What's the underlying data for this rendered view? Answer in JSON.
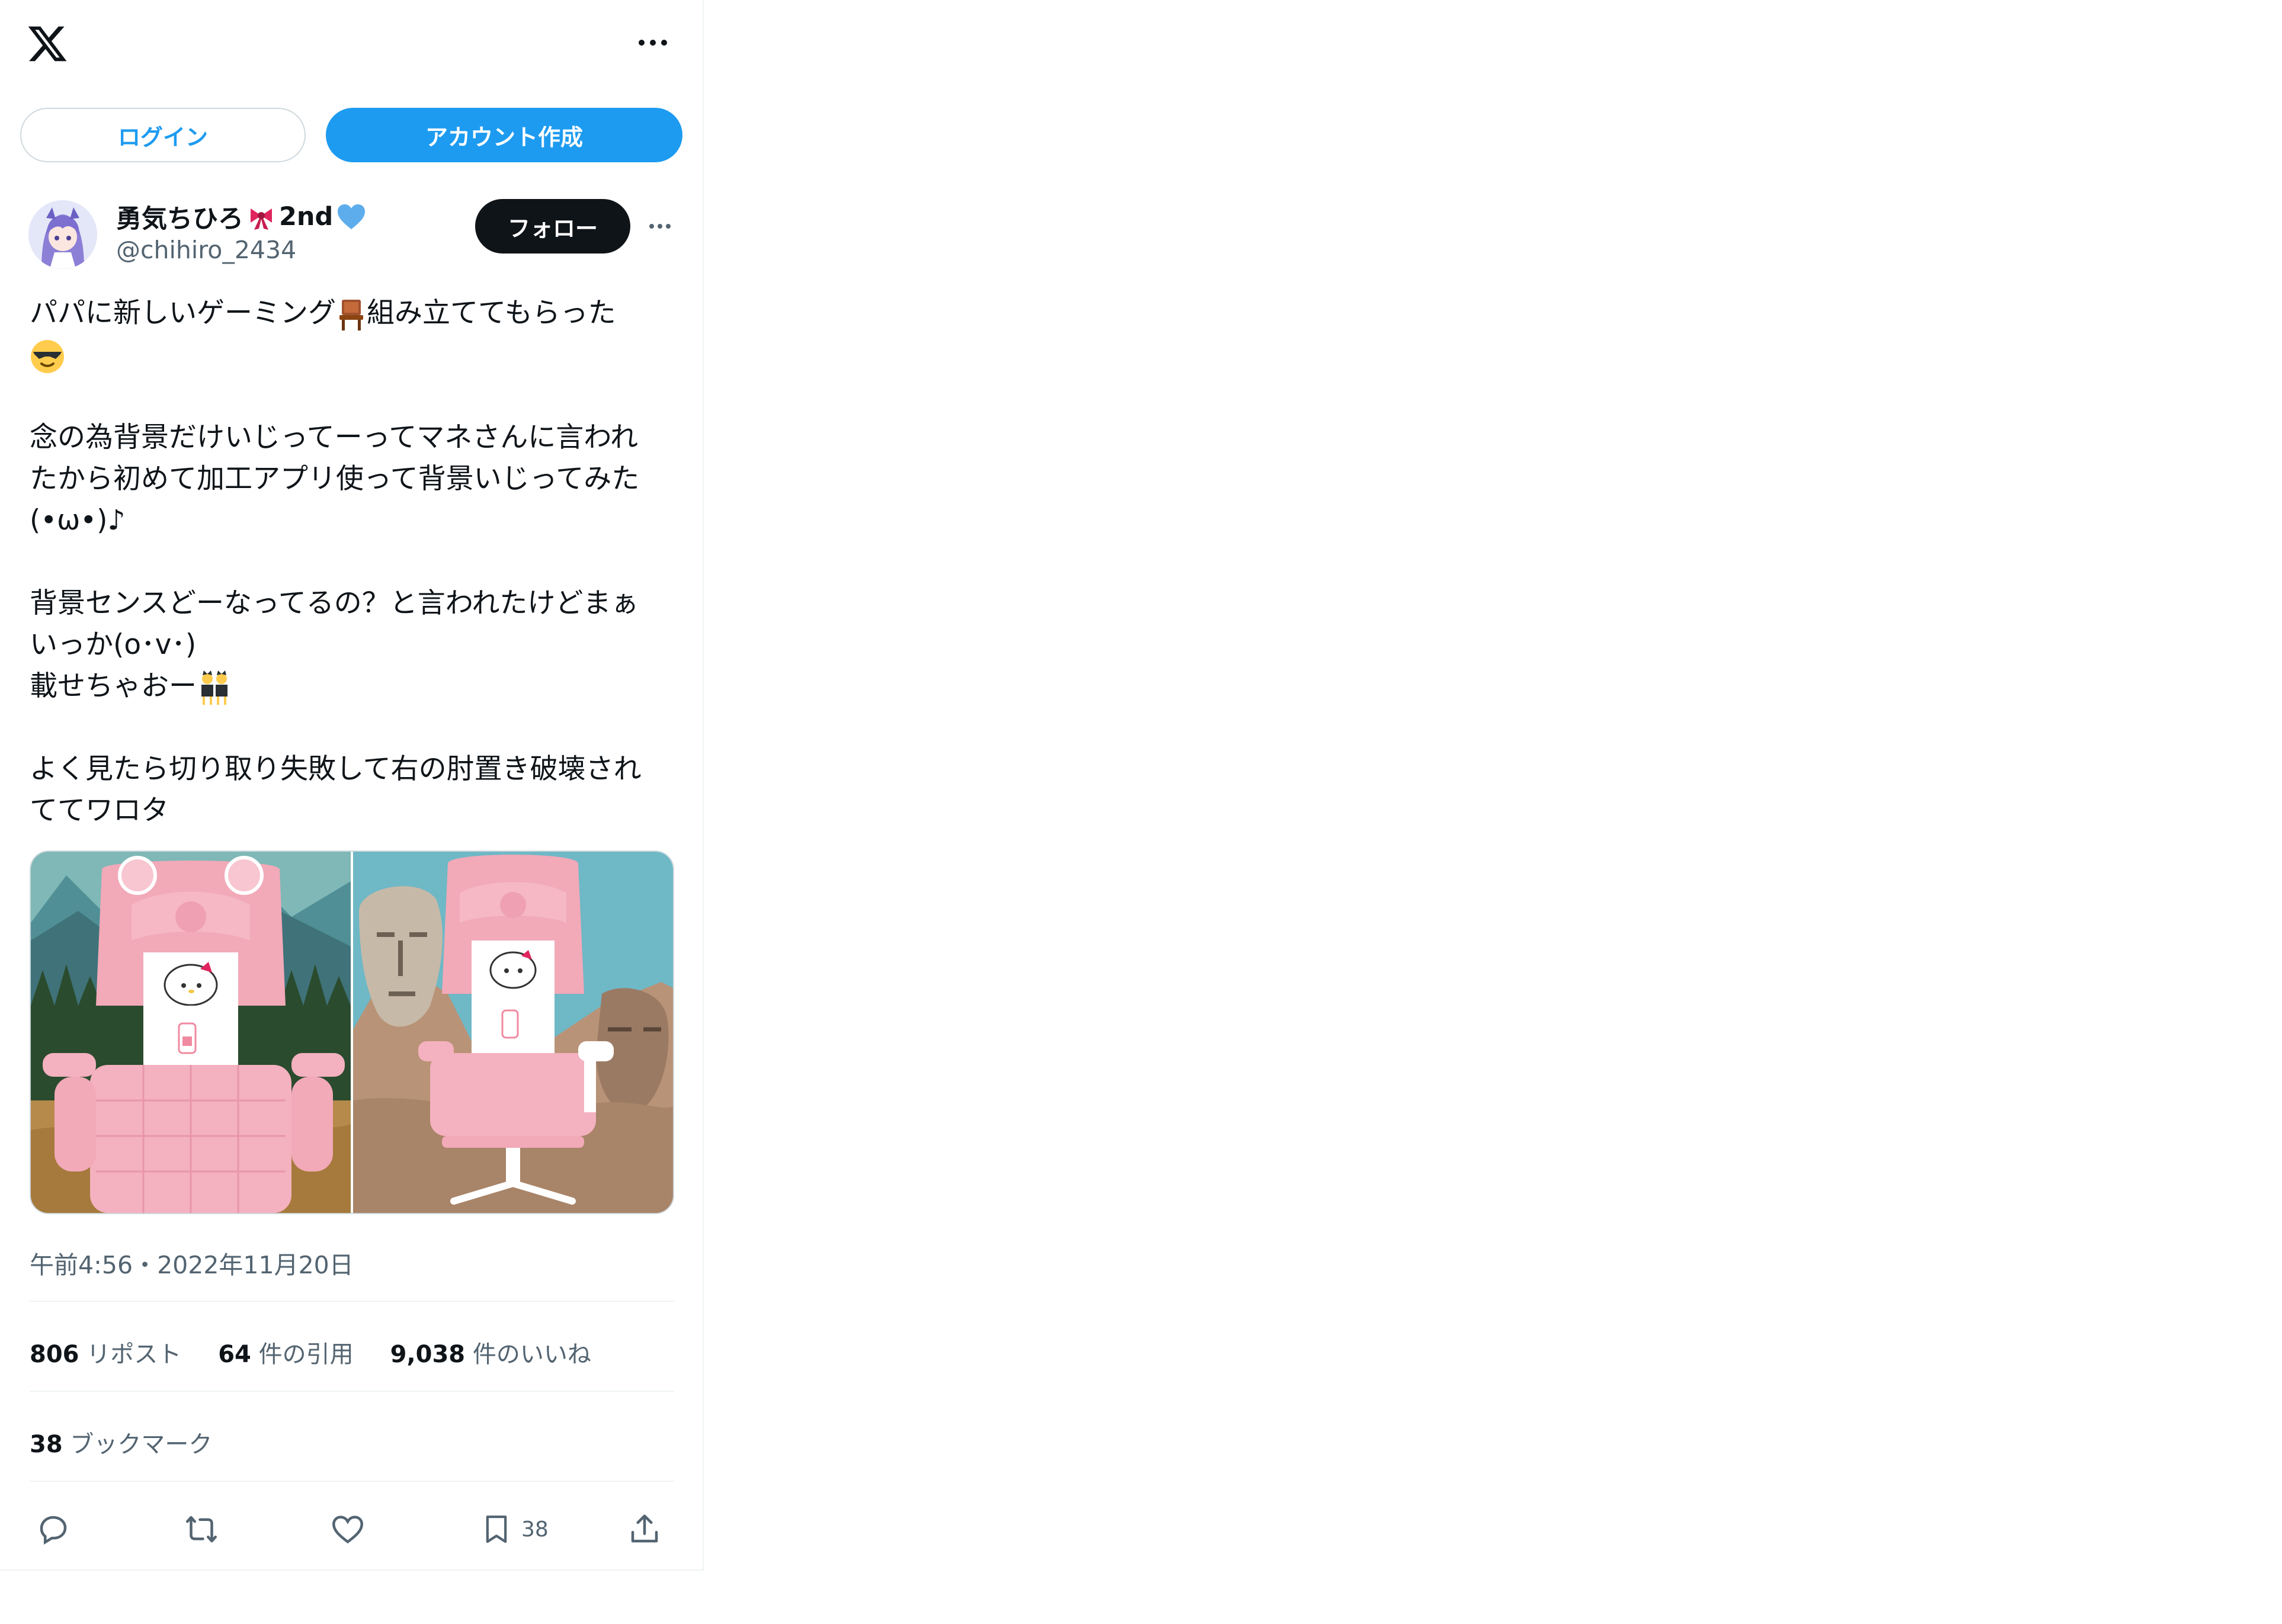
{
  "header": {
    "logo": "x-logo-icon",
    "more": "more-icon"
  },
  "auth": {
    "login_label": "ログイン",
    "signup_label": "アカウント作成"
  },
  "post": {
    "display_name": "勇気ちひろ",
    "display_name_suffix": "2nd",
    "handle": "@chihiro_2434",
    "follow_label": "フォロー",
    "lines": {
      "l1": "パパに新しいゲーミング",
      "l1b": "組み立ててもらった",
      "l3": "念の為背景だけいじってーってマネさんに言われ",
      "l4": "たから初めて加工アプリ使って背景いじってみた",
      "l5": "(⁠•ω•)⁠♪",
      "l7": "背景センスどーなってるの？と言われたけどまぁ",
      "l8": "いっか(o･v･)",
      "l9": "載せちゃおー",
      "l11": "よく見たら切り取り失敗して右の肘置き破壊され",
      "l12": "ててワロタ"
    },
    "timestamp": "午前4:56・2022年11月20日",
    "stats": {
      "reposts_count": "806",
      "reposts_label": "リポスト",
      "quotes_count": "64",
      "quotes_label": "件の引用",
      "likes_count": "9,038",
      "likes_label": "件のいいね"
    },
    "bookmarks": {
      "count": "38",
      "label": "ブックマーク"
    },
    "actions": {
      "bookmark_count": "38"
    }
  },
  "colors": {
    "accent": "#1d9bf0",
    "text": "#0f1419",
    "muted": "#536471",
    "border": "#cfd9de"
  }
}
